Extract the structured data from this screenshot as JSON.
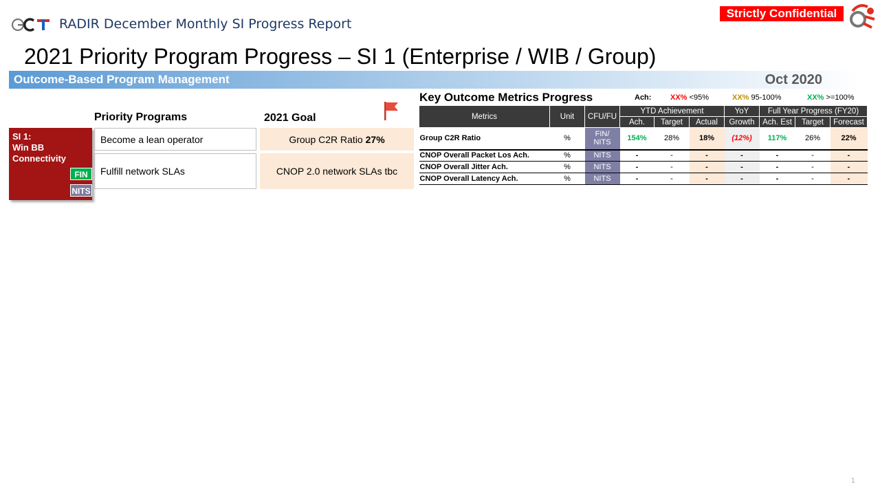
{
  "header": {
    "logo_text": "GCT",
    "report_title": "RADIR December Monthly SI Progress Report",
    "confidential": "Strictly Confidential"
  },
  "title": "2021 Priority Program Progress – SI 1 (Enterprise / WIB / Group)",
  "banner": {
    "label": "Outcome-Based Program Management",
    "date": "Oct 2020"
  },
  "left": {
    "col_programs": "Priority Programs",
    "col_goal": "2021 Goal",
    "si_label": "SI 1:\nWin BB\nConnectivity",
    "tag_fin": "FIN",
    "tag_nits": "NITS",
    "programs": [
      {
        "name": "Become a lean operator",
        "goal_text": "Group C2R Ratio ",
        "goal_value": "27%"
      },
      {
        "name": "Fulfill network SLAs",
        "goal_text": "CNOP 2.0 network SLAs tbc",
        "goal_value": ""
      }
    ]
  },
  "kom": {
    "title": "Key Outcome Metrics Progress",
    "legend": {
      "ach_label": "Ach:",
      "red_xx": "XX%",
      "red_text": "<95%",
      "amber_xx": "XX%",
      "amber_text": "95-100%",
      "green_xx": "XX%",
      "green_text": ">=100%",
      "colors": {
        "red": "#ff0000",
        "amber": "#bf9000",
        "green": "#00b050"
      }
    },
    "headers": {
      "metrics": "Metrics",
      "unit": "Unit",
      "cfu": "CFU/FU",
      "ytd": "YTD Achievement",
      "yoy": "YoY",
      "growth": "Growth",
      "fy": "Full Year Progress (FY20)",
      "ach": "Ach.",
      "target": "Target",
      "actual": "Actual",
      "ach_est": "Ach. Est",
      "fy_target": "Target",
      "forecast": "Forecast"
    },
    "rows": [
      {
        "metric": "Group C2R Ratio",
        "unit": "%",
        "cfu": "FIN/\nNITS",
        "ach": "154%",
        "target": "28%",
        "actual": "18%",
        "yoy": "(12%)",
        "ach_est": "117%",
        "fy_target": "26%",
        "forecast": "22%"
      },
      {
        "metric": "CNOP Overall Packet Los Ach.",
        "unit": "%",
        "cfu": "NITS",
        "ach": "-",
        "target": "-",
        "actual": "-",
        "yoy": "-",
        "ach_est": "-",
        "fy_target": "-",
        "forecast": "-"
      },
      {
        "metric": "CNOP Overall Jitter Ach.",
        "unit": "%",
        "cfu": "NITS",
        "ach": "-",
        "target": "-",
        "actual": "-",
        "yoy": "-",
        "ach_est": "-",
        "fy_target": "-",
        "forecast": "-"
      },
      {
        "metric": "CNOP Overall Latency Ach.",
        "unit": "%",
        "cfu": "NITS",
        "ach": "-",
        "target": "-",
        "actual": "-",
        "yoy": "-",
        "ach_est": "-",
        "fy_target": "-",
        "forecast": "-"
      }
    ]
  },
  "page_number": "1"
}
